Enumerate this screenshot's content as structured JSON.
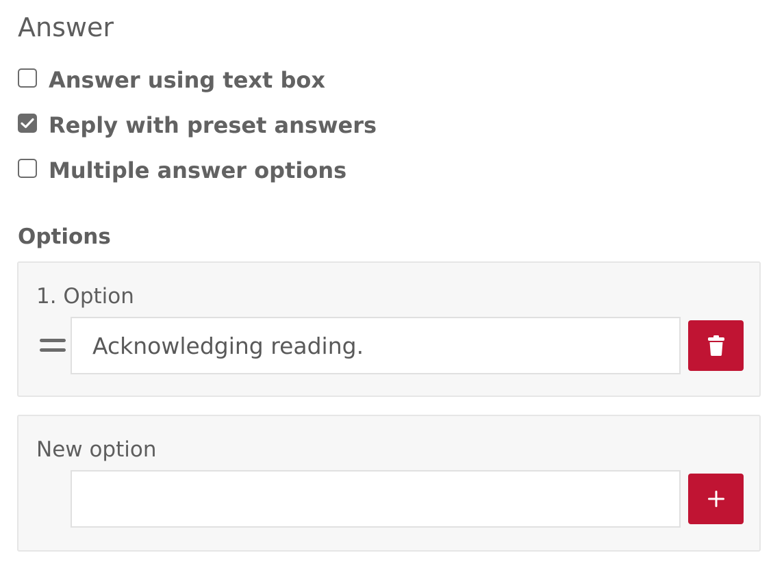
{
  "answer_section": {
    "title": "Answer",
    "choices": [
      {
        "label": "Answer using text box",
        "checked": false,
        "icon": "checkbox-unchecked-icon"
      },
      {
        "label": "Reply with preset answers",
        "checked": true,
        "icon": "checkbox-checked-icon"
      },
      {
        "label": "Multiple answer options",
        "checked": false,
        "icon": "checkbox-unchecked-icon"
      }
    ]
  },
  "options_section": {
    "heading": "Options",
    "items": [
      {
        "label": "1. Option",
        "value": "Acknowledging reading.",
        "drag_icon": "drag-handle-icon",
        "action_icon": "trash-icon"
      }
    ],
    "new_option": {
      "label": "New option",
      "value": "",
      "action_icon": "plus-icon"
    }
  },
  "colors": {
    "accent": "#c01433",
    "panel_bg": "#f7f7f7",
    "text": "#5b5b5b"
  }
}
